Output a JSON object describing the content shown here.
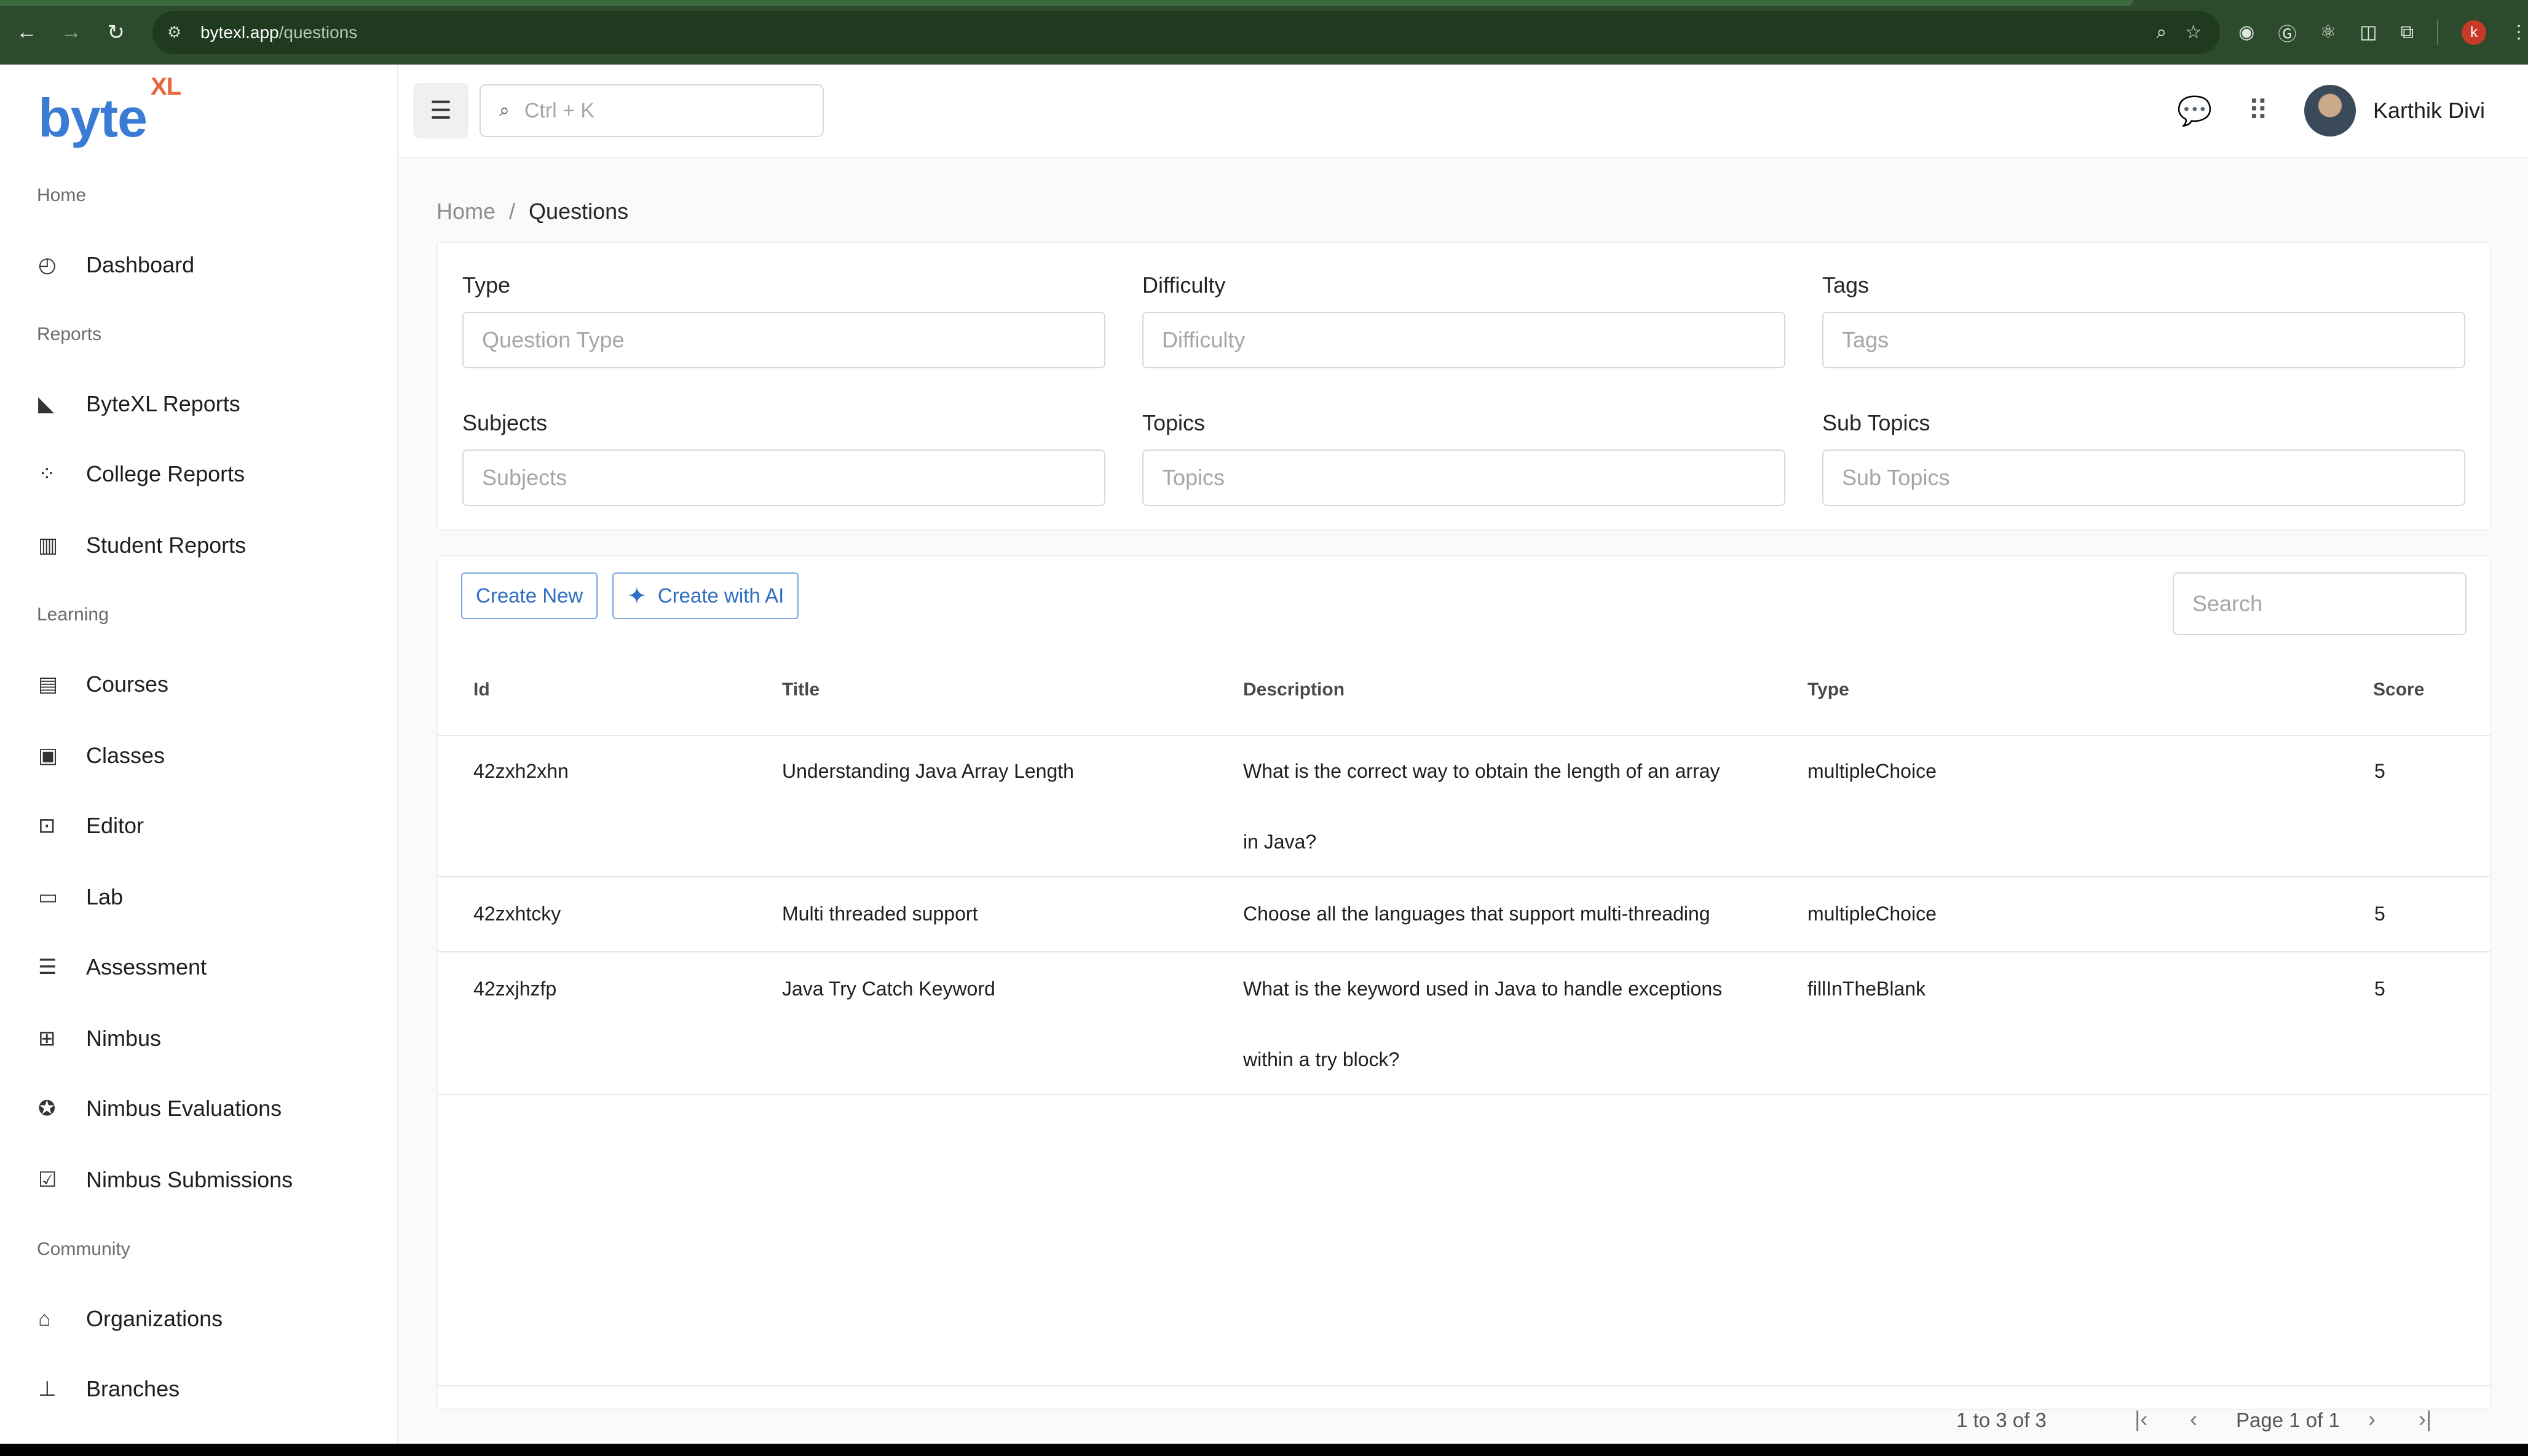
{
  "browser": {
    "url_host": "bytexl.app",
    "url_path": "/questions",
    "profile_initial": "k"
  },
  "logo": {
    "main": "byte",
    "sup": "XL"
  },
  "sidebar": {
    "sections": {
      "home": "Home",
      "reports": "Reports",
      "learning": "Learning",
      "community": "Community"
    },
    "items": [
      {
        "label": "Dashboard",
        "icon": "dashboard-icon"
      },
      {
        "label": "ByteXL Reports",
        "icon": "area-chart-icon"
      },
      {
        "label": "College Reports",
        "icon": "scatter-chart-icon"
      },
      {
        "label": "Student Reports",
        "icon": "bar-chart-icon"
      },
      {
        "label": "Courses",
        "icon": "book-icon"
      },
      {
        "label": "Classes",
        "icon": "id-card-icon"
      },
      {
        "label": "Editor",
        "icon": "terminal-icon"
      },
      {
        "label": "Lab",
        "icon": "laptop-icon"
      },
      {
        "label": "Assessment",
        "icon": "assessment-icon"
      },
      {
        "label": "Nimbus",
        "icon": "grid-plus-icon"
      },
      {
        "label": "Nimbus Evaluations",
        "icon": "award-icon"
      },
      {
        "label": "Nimbus Submissions",
        "icon": "calendar-check-icon"
      },
      {
        "label": "Organizations",
        "icon": "bank-icon"
      },
      {
        "label": "Branches",
        "icon": "hierarchy-icon"
      }
    ]
  },
  "topbar": {
    "search_placeholder": "Ctrl + K",
    "user_name": "Karthik Divi"
  },
  "breadcrumb": {
    "home": "Home",
    "separator": "/",
    "current": "Questions"
  },
  "filters": {
    "type": {
      "label": "Type",
      "placeholder": "Question Type"
    },
    "difficulty": {
      "label": "Difficulty",
      "placeholder": "Difficulty"
    },
    "tags": {
      "label": "Tags",
      "placeholder": "Tags"
    },
    "subjects": {
      "label": "Subjects",
      "placeholder": "Subjects"
    },
    "topics": {
      "label": "Topics",
      "placeholder": "Topics"
    },
    "sub_topics": {
      "label": "Sub Topics",
      "placeholder": "Sub Topics"
    }
  },
  "toolbar": {
    "create_new": "Create New",
    "create_ai": "Create with AI",
    "search_placeholder": "Search"
  },
  "table": {
    "columns": {
      "id": "Id",
      "title": "Title",
      "description": "Description",
      "type": "Type",
      "score": "Score"
    },
    "rows": [
      {
        "id": "42zxh2xhn",
        "title": "Understanding Java Array Length",
        "desc1": "What is the correct way to obtain the length of an array",
        "desc2": "in Java?",
        "type": "multipleChoice",
        "score": "5"
      },
      {
        "id": "42zxhtcky",
        "title": "Multi threaded support",
        "desc1": "Choose all the languages that support multi-threading",
        "desc2": "",
        "type": "multipleChoice",
        "score": "5"
      },
      {
        "id": "42zxjhzfp",
        "title": "Java Try Catch Keyword",
        "desc1": "What is the keyword used in Java to handle exceptions",
        "desc2": "within a try block?",
        "type": "fillInTheBlank",
        "score": "5"
      }
    ]
  },
  "pagination": {
    "range": "1 to 3 of 3",
    "page": "Page 1 of 1"
  },
  "colors": {
    "brand": "#3a7bd5",
    "accent": "#e8663a",
    "browser": "#2c4a2c"
  }
}
